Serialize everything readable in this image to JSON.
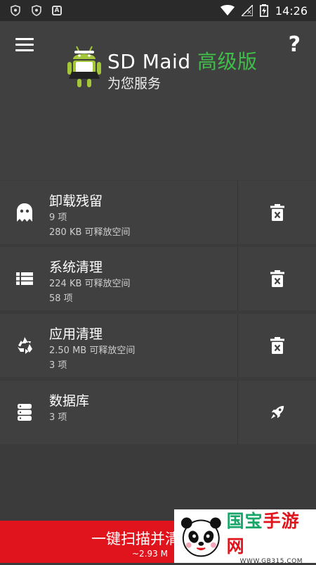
{
  "status_bar": {
    "time": "14:26",
    "badge_label": "A"
  },
  "header": {
    "app_name": "SD Maid",
    "pro_label": "高级版",
    "subtitle": "为您服务",
    "help_label": "?"
  },
  "tools": [
    {
      "title": "卸载残留",
      "line1": "9 项",
      "line2": "280 KB 可释放空间",
      "icon": "ghost-icon",
      "action_icon": "trash-delete-icon"
    },
    {
      "title": "系统清理",
      "line1": "224 KB 可释放空间",
      "line2": "58 项",
      "icon": "list-icon",
      "action_icon": "trash-delete-icon"
    },
    {
      "title": "应用清理",
      "line1": "2.50 MB 可释放空间",
      "line2": "3 项",
      "icon": "recycle-icon",
      "action_icon": "trash-delete-icon"
    },
    {
      "title": "数据库",
      "line1": "3 项",
      "line2": "",
      "icon": "database-icon",
      "action_icon": "rocket-icon"
    }
  ],
  "scan_bar": {
    "title": "一键扫描并清",
    "subtitle": "~2.93 M"
  },
  "watermark": {
    "text_green": "国宝",
    "text_red": "手游网",
    "url": "WWW.GB315.COM"
  },
  "colors": {
    "background": "#3b3b3b",
    "card": "#404040",
    "accent_green": "#3fbf4a",
    "scan_red": "#e0141c"
  }
}
